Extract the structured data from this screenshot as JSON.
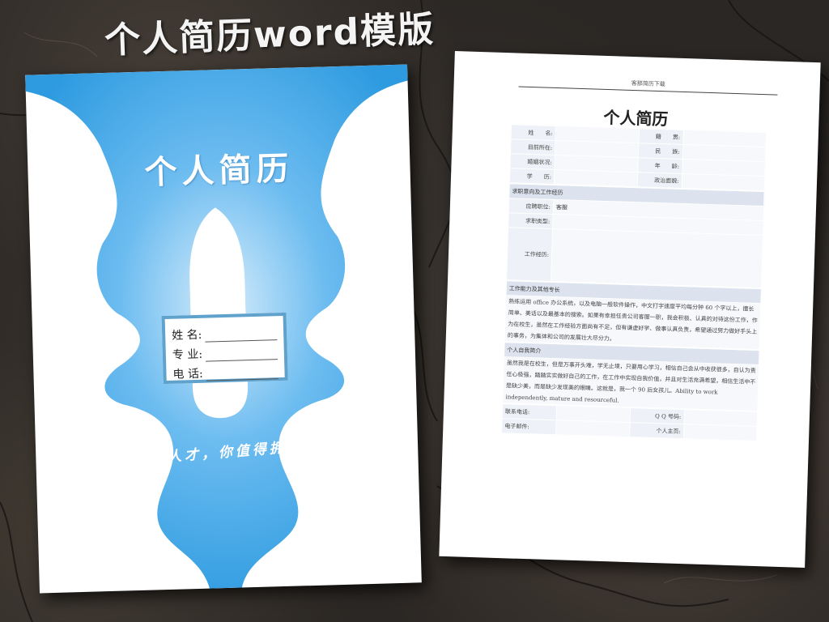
{
  "banner": {
    "title": "个人简历word模版"
  },
  "cover": {
    "title": "个人简历",
    "card": {
      "name_label": "姓 名:",
      "major_label": "专 业:",
      "phone_label": "电 话:"
    },
    "slogan": "专业人才，你值得拥有！",
    "accent_color": "#2e9be0"
  },
  "resume": {
    "header": "客那简历下载",
    "title": "个人简历",
    "basic": {
      "name": "姓　　名:",
      "native": "籍　　贯:",
      "residence": "目前所在:",
      "ethnicity": "民　　族:",
      "marital": "婚姻状况:",
      "age": "年　　龄:",
      "education": "学　　历:",
      "political": "政治面貌:"
    },
    "job_section": "求职意向及工作经历",
    "job_position_label": "应聘职位:",
    "job_position_value": "客服",
    "job_type_label": "求职类型:",
    "experience_label": "工作经历:",
    "ability_section": "工作能力及其他专长",
    "ability_text": "熟练运用 office 办公系统，以及电脑一般软件操作，中文打字速度平均每分钟 60 个字以上，擅长简单、美话以及最基本的搜索。如果有幸担任贵公司客服一职，我会积极、认真的对待这份工作，作为在校生，虽然在工作经验方面尚有不足，但有谦虚好学、做事认真负责，希望通过努力做好手头上的事务，为集体和公司的发展壮大尽分力。",
    "intro_section": "个人自我简介",
    "intro_text": "虽然我是在校生，但是万事开头难，学无止境，只要用心学习，相信自己会从中收获很多，自认为责任心极强，踏踏实实做好自己的工作，在工作中实现自我价值，并且对生活充满希望，相信生活中不是缺少美，而是缺少发现美的眼睛。这就是，我一个 90 后女孩儿。Ability to work independently, mature and resourceful.",
    "contact": {
      "phone": "联系电话:",
      "qq": "Q Q 号码:",
      "email": "电子邮件:",
      "homepage": "个人主页:"
    }
  }
}
